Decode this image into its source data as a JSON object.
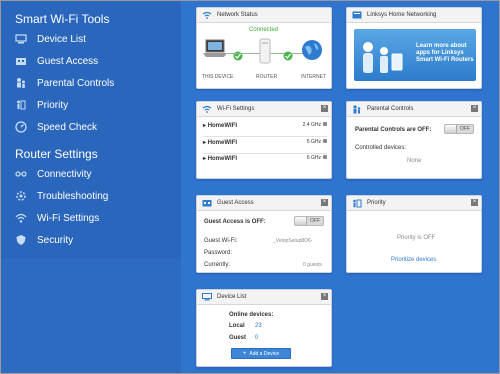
{
  "sidebar": {
    "tools_heading": "Smart Wi-Fi Tools",
    "tools": [
      {
        "label": "Device List",
        "icon": "device-list-icon"
      },
      {
        "label": "Guest Access",
        "icon": "guest-access-icon"
      },
      {
        "label": "Parental Controls",
        "icon": "parental-controls-icon"
      },
      {
        "label": "Priority",
        "icon": "priority-icon"
      },
      {
        "label": "Speed Check",
        "icon": "speed-check-icon"
      }
    ],
    "router_heading": "Router Settings",
    "router": [
      {
        "label": "Connectivity",
        "icon": "connectivity-icon"
      },
      {
        "label": "Troubleshooting",
        "icon": "troubleshooting-icon"
      },
      {
        "label": "Wi-Fi Settings",
        "icon": "wifi-icon"
      },
      {
        "label": "Security",
        "icon": "shield-icon"
      }
    ]
  },
  "network_status": {
    "title": "Network Status",
    "connected": "Connected",
    "this_device": "THIS DEVICE",
    "router": "ROUTER",
    "internet": "INTERNET"
  },
  "linksys": {
    "title": "Linksys Home Networking",
    "promo": "Learn more about apps for Linksys Smart Wi-Fi Routers"
  },
  "wifi_settings": {
    "title": "Wi-Fi Settings",
    "networks": [
      {
        "name": "HomeWIFI",
        "band": "2.4 GHz"
      },
      {
        "name": "HomeWIFI",
        "band": "5 GHz"
      },
      {
        "name": "HomeWIFI",
        "band": "6 GHz"
      }
    ]
  },
  "parental_controls": {
    "title": "Parental Controls",
    "status": "Parental Controls are OFF:",
    "toggle": "OFF",
    "controlled_label": "Controlled devices:",
    "controlled_value": "None"
  },
  "guest_access": {
    "title": "Guest Access",
    "status": "Guest Access is OFF:",
    "toggle": "OFF",
    "wifi_label": "Guest Wi-Fi:",
    "wifi_value": "_VelopSetup8O6-",
    "password_label": "Password:",
    "currently_label": "Currently:",
    "currently_value": "0 guests"
  },
  "priority": {
    "title": "Priority",
    "status": "Priority is OFF",
    "link": "Prioritize devices"
  },
  "device_list": {
    "title": "Device List",
    "online_label": "Online devices:",
    "local_label": "Local",
    "local_value": "23",
    "guest_label": "Guest",
    "guest_value": "0",
    "add_button": "Add a Device"
  }
}
